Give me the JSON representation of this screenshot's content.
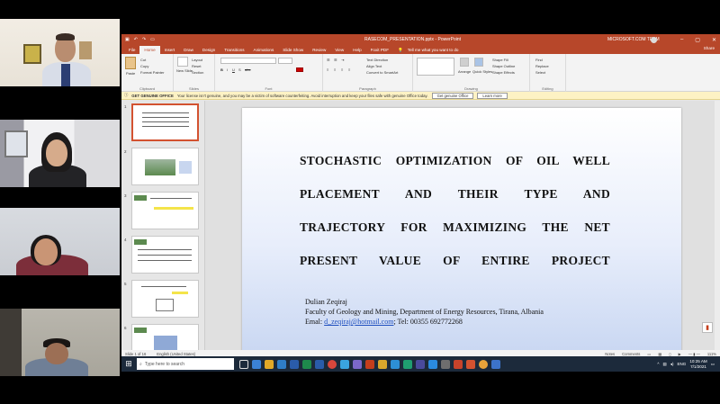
{
  "participants": [
    {
      "role": "video-tile"
    },
    {
      "role": "video-tile"
    },
    {
      "role": "video-tile"
    },
    {
      "role": "video-tile"
    }
  ],
  "window": {
    "file_title": "RASECOM_PRESENTATION.pptx - PowerPoint",
    "account": "MICROSOFT.COM TEAM",
    "tell_me": "Tell me what you want to do",
    "share": "Share",
    "controls": [
      "–",
      "▢",
      "✕"
    ]
  },
  "ribbon_tabs": [
    "File",
    "Home",
    "Insert",
    "Draw",
    "Design",
    "Transitions",
    "Animations",
    "Slide Show",
    "Review",
    "View",
    "Help",
    "Foxit PDF"
  ],
  "active_tab": "Home",
  "ribbon_groups": {
    "clipboard": {
      "label": "Clipboard",
      "paste": "Paste",
      "cut": "Cut",
      "copy": "Copy",
      "format_painter": "Format Painter"
    },
    "slides": {
      "label": "Slides",
      "new_slide": "New Slide",
      "layout": "Layout",
      "reset": "Reset",
      "section": "Section"
    },
    "font": {
      "label": "Font"
    },
    "paragraph": {
      "label": "Paragraph",
      "text_direction": "Text Direction",
      "align_text": "Align Text",
      "smartart": "Convert to SmartArt"
    },
    "drawing": {
      "label": "Drawing",
      "arrange": "Arrange",
      "quick_styles": "Quick Styles",
      "shape_fill": "Shape Fill",
      "shape_outline": "Shape Outline",
      "shape_effects": "Shape Effects"
    },
    "editing": {
      "label": "Editing",
      "find": "Find",
      "replace": "Replace",
      "select": "Select"
    }
  },
  "notice": {
    "title": "GET GENUINE OFFICE",
    "message": "Your license isn't genuine, and you may be a victim of software counterfeiting. Avoid interruption and keep your files safe with genuine Office today.",
    "btn_get": "Get genuine Office",
    "btn_learn": "Learn more"
  },
  "thumbnails": [
    "1",
    "2",
    "3",
    "4",
    "5",
    "6"
  ],
  "slide": {
    "title_lines": [
      "STOCHASTIC OPTIMIZATION OF OIL WELL",
      "PLACEMENT AND THEIR TYPE AND",
      "TRAJECTORY FOR MAXIMIZING THE NET",
      "PRESENT VALUE OF ENTIRE PROJECT"
    ],
    "author": "Dulian Zeqiraj",
    "affiliation": "Faculty of Geology and Mining, Department of Energy Resources, Tirana, Albania",
    "email_label": "Emal: ",
    "email": "d_zeqiraj@hotmail.com",
    "phone": "; Tel: 00355 692772268"
  },
  "status": {
    "slide_of": "Slide 1 of 16",
    "language": "English (United States)",
    "notes": "Notes",
    "comments": "Comments",
    "zoom": "111%"
  },
  "taskbar": {
    "search_placeholder": "Type here to search",
    "language": "ENG",
    "time": "10:25 AM",
    "date": "7/1/2021"
  },
  "colors": {
    "ppt_accent": "#b7472a",
    "taskbar": "#1c2a3b",
    "notice": "#fdf2c4",
    "link": "#1f4fbf"
  }
}
